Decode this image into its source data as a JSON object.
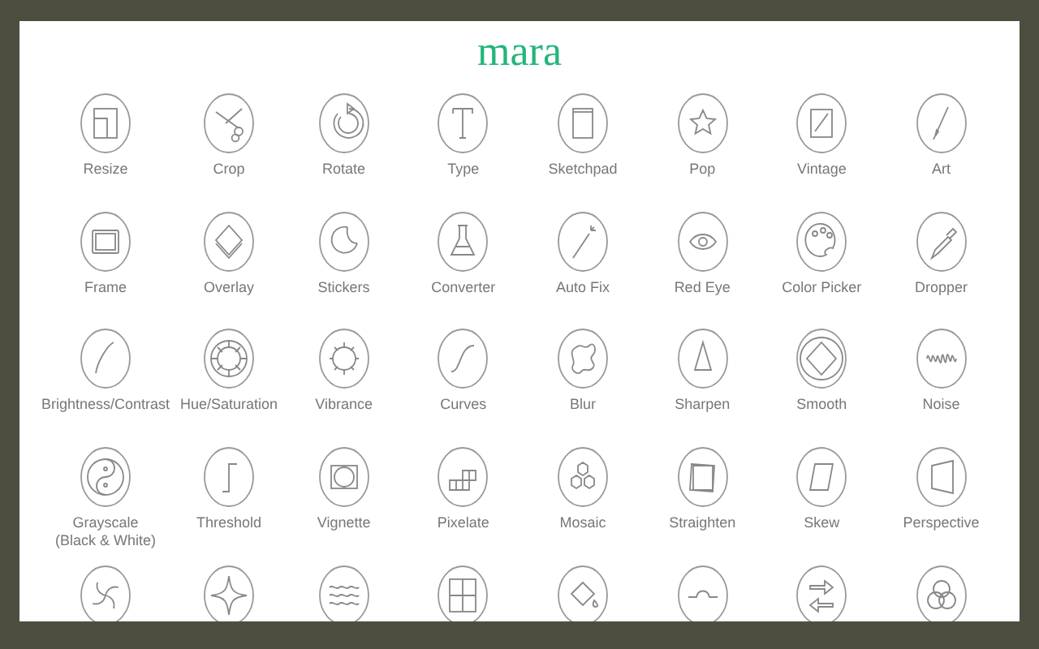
{
  "logo": "mara",
  "tools": [
    {
      "kind": "resize",
      "label": "Resize"
    },
    {
      "kind": "crop",
      "label": "Crop"
    },
    {
      "kind": "rotate",
      "label": "Rotate"
    },
    {
      "kind": "type",
      "label": "Type"
    },
    {
      "kind": "sketchpad",
      "label": "Sketchpad"
    },
    {
      "kind": "pop",
      "label": "Pop"
    },
    {
      "kind": "vintage",
      "label": "Vintage"
    },
    {
      "kind": "art",
      "label": "Art"
    },
    {
      "kind": "frame",
      "label": "Frame"
    },
    {
      "kind": "overlay",
      "label": "Overlay"
    },
    {
      "kind": "stickers",
      "label": "Stickers"
    },
    {
      "kind": "converter",
      "label": "Converter"
    },
    {
      "kind": "autofix",
      "label": "Auto Fix"
    },
    {
      "kind": "redeye",
      "label": "Red Eye"
    },
    {
      "kind": "colorpicker",
      "label": "Color Picker"
    },
    {
      "kind": "dropper",
      "label": "Dropper"
    },
    {
      "kind": "brightness",
      "label": "Brightness/Contrast"
    },
    {
      "kind": "hue",
      "label": "Hue/Saturation"
    },
    {
      "kind": "vibrance",
      "label": "Vibrance"
    },
    {
      "kind": "curves",
      "label": "Curves"
    },
    {
      "kind": "blur",
      "label": "Blur"
    },
    {
      "kind": "sharpen",
      "label": "Sharpen"
    },
    {
      "kind": "smooth",
      "label": "Smooth"
    },
    {
      "kind": "noise",
      "label": "Noise"
    },
    {
      "kind": "grayscale",
      "label": "Grayscale\n(Black & White)"
    },
    {
      "kind": "threshold",
      "label": "Threshold"
    },
    {
      "kind": "vignette",
      "label": "Vignette"
    },
    {
      "kind": "pixelate",
      "label": "Pixelate"
    },
    {
      "kind": "mosaic",
      "label": "Mosaic"
    },
    {
      "kind": "straighten",
      "label": "Straighten"
    },
    {
      "kind": "skew",
      "label": "Skew"
    },
    {
      "kind": "perspective",
      "label": "Perspective"
    },
    {
      "kind": "swirl"
    },
    {
      "kind": "pinch"
    },
    {
      "kind": "waves"
    },
    {
      "kind": "grid"
    },
    {
      "kind": "fill"
    },
    {
      "kind": "bump"
    },
    {
      "kind": "flip"
    },
    {
      "kind": "colors"
    }
  ]
}
